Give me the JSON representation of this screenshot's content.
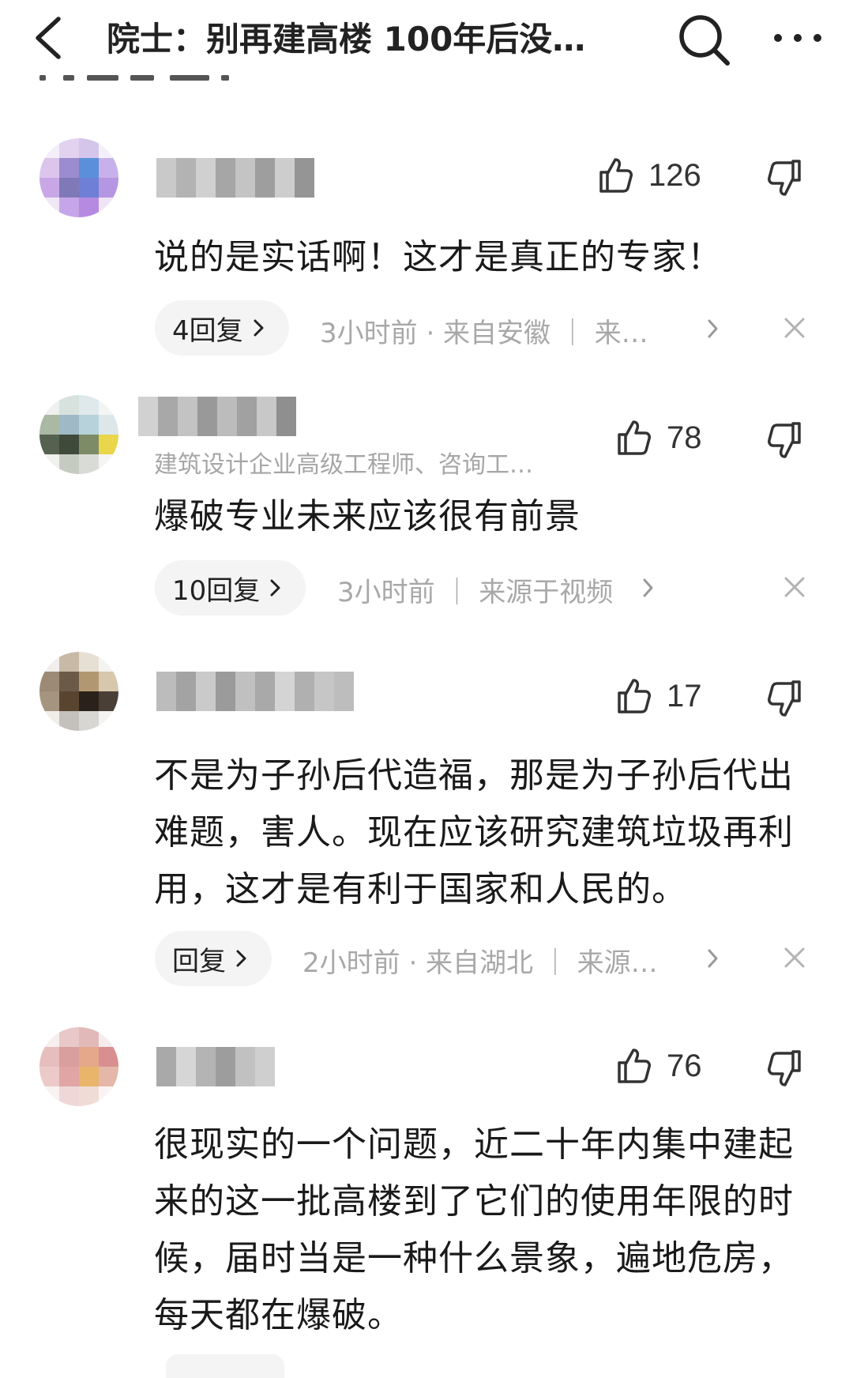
{
  "header": {
    "title": "院士：别再建高楼 100年后没…"
  },
  "comments": [
    {
      "subtitle": "",
      "likes": "126",
      "text": "说的是实话啊！这才是真正的专家！",
      "reply_label": "4回复",
      "meta": "3小时前 · 来自安徽 ｜ 来…"
    },
    {
      "subtitle": "建筑设计企业高级工程师、咨询工…",
      "likes": "78",
      "text": "爆破专业未来应该很有前景",
      "reply_label": "10回复",
      "meta": "3小时前 ｜ 来源于视频"
    },
    {
      "subtitle": "",
      "likes": "17",
      "text": "不是为子孙后代造福，那是为子孙后代出难题，害人。现在应该研究建筑垃圾再利用，这才是有利于国家和人民的。",
      "reply_label": "回复",
      "meta": "2小时前 · 来自湖北 ｜ 来源…"
    },
    {
      "subtitle": "",
      "likes": "76",
      "text": "很现实的一个问题，近二十年内集中建起来的这一批高楼到了它们的使用年限的时候，届时当是一种什么景象，遍地危房，每天都在爆破。",
      "reply_label": "",
      "meta": ""
    }
  ],
  "icons": {
    "back": "chevron-left-icon",
    "search": "search-icon",
    "more": "more-dots-icon",
    "like": "thumbs-up-icon",
    "dislike": "thumbs-down-icon",
    "reply_chevron": "chevron-right-icon",
    "meta_chevron": "chevron-right-icon",
    "close": "close-icon"
  },
  "colors": {
    "text": "#1a1a1a",
    "meta": "#a8a8a8",
    "reply_bg": "#f4f4f4",
    "background": "#ffffff"
  }
}
